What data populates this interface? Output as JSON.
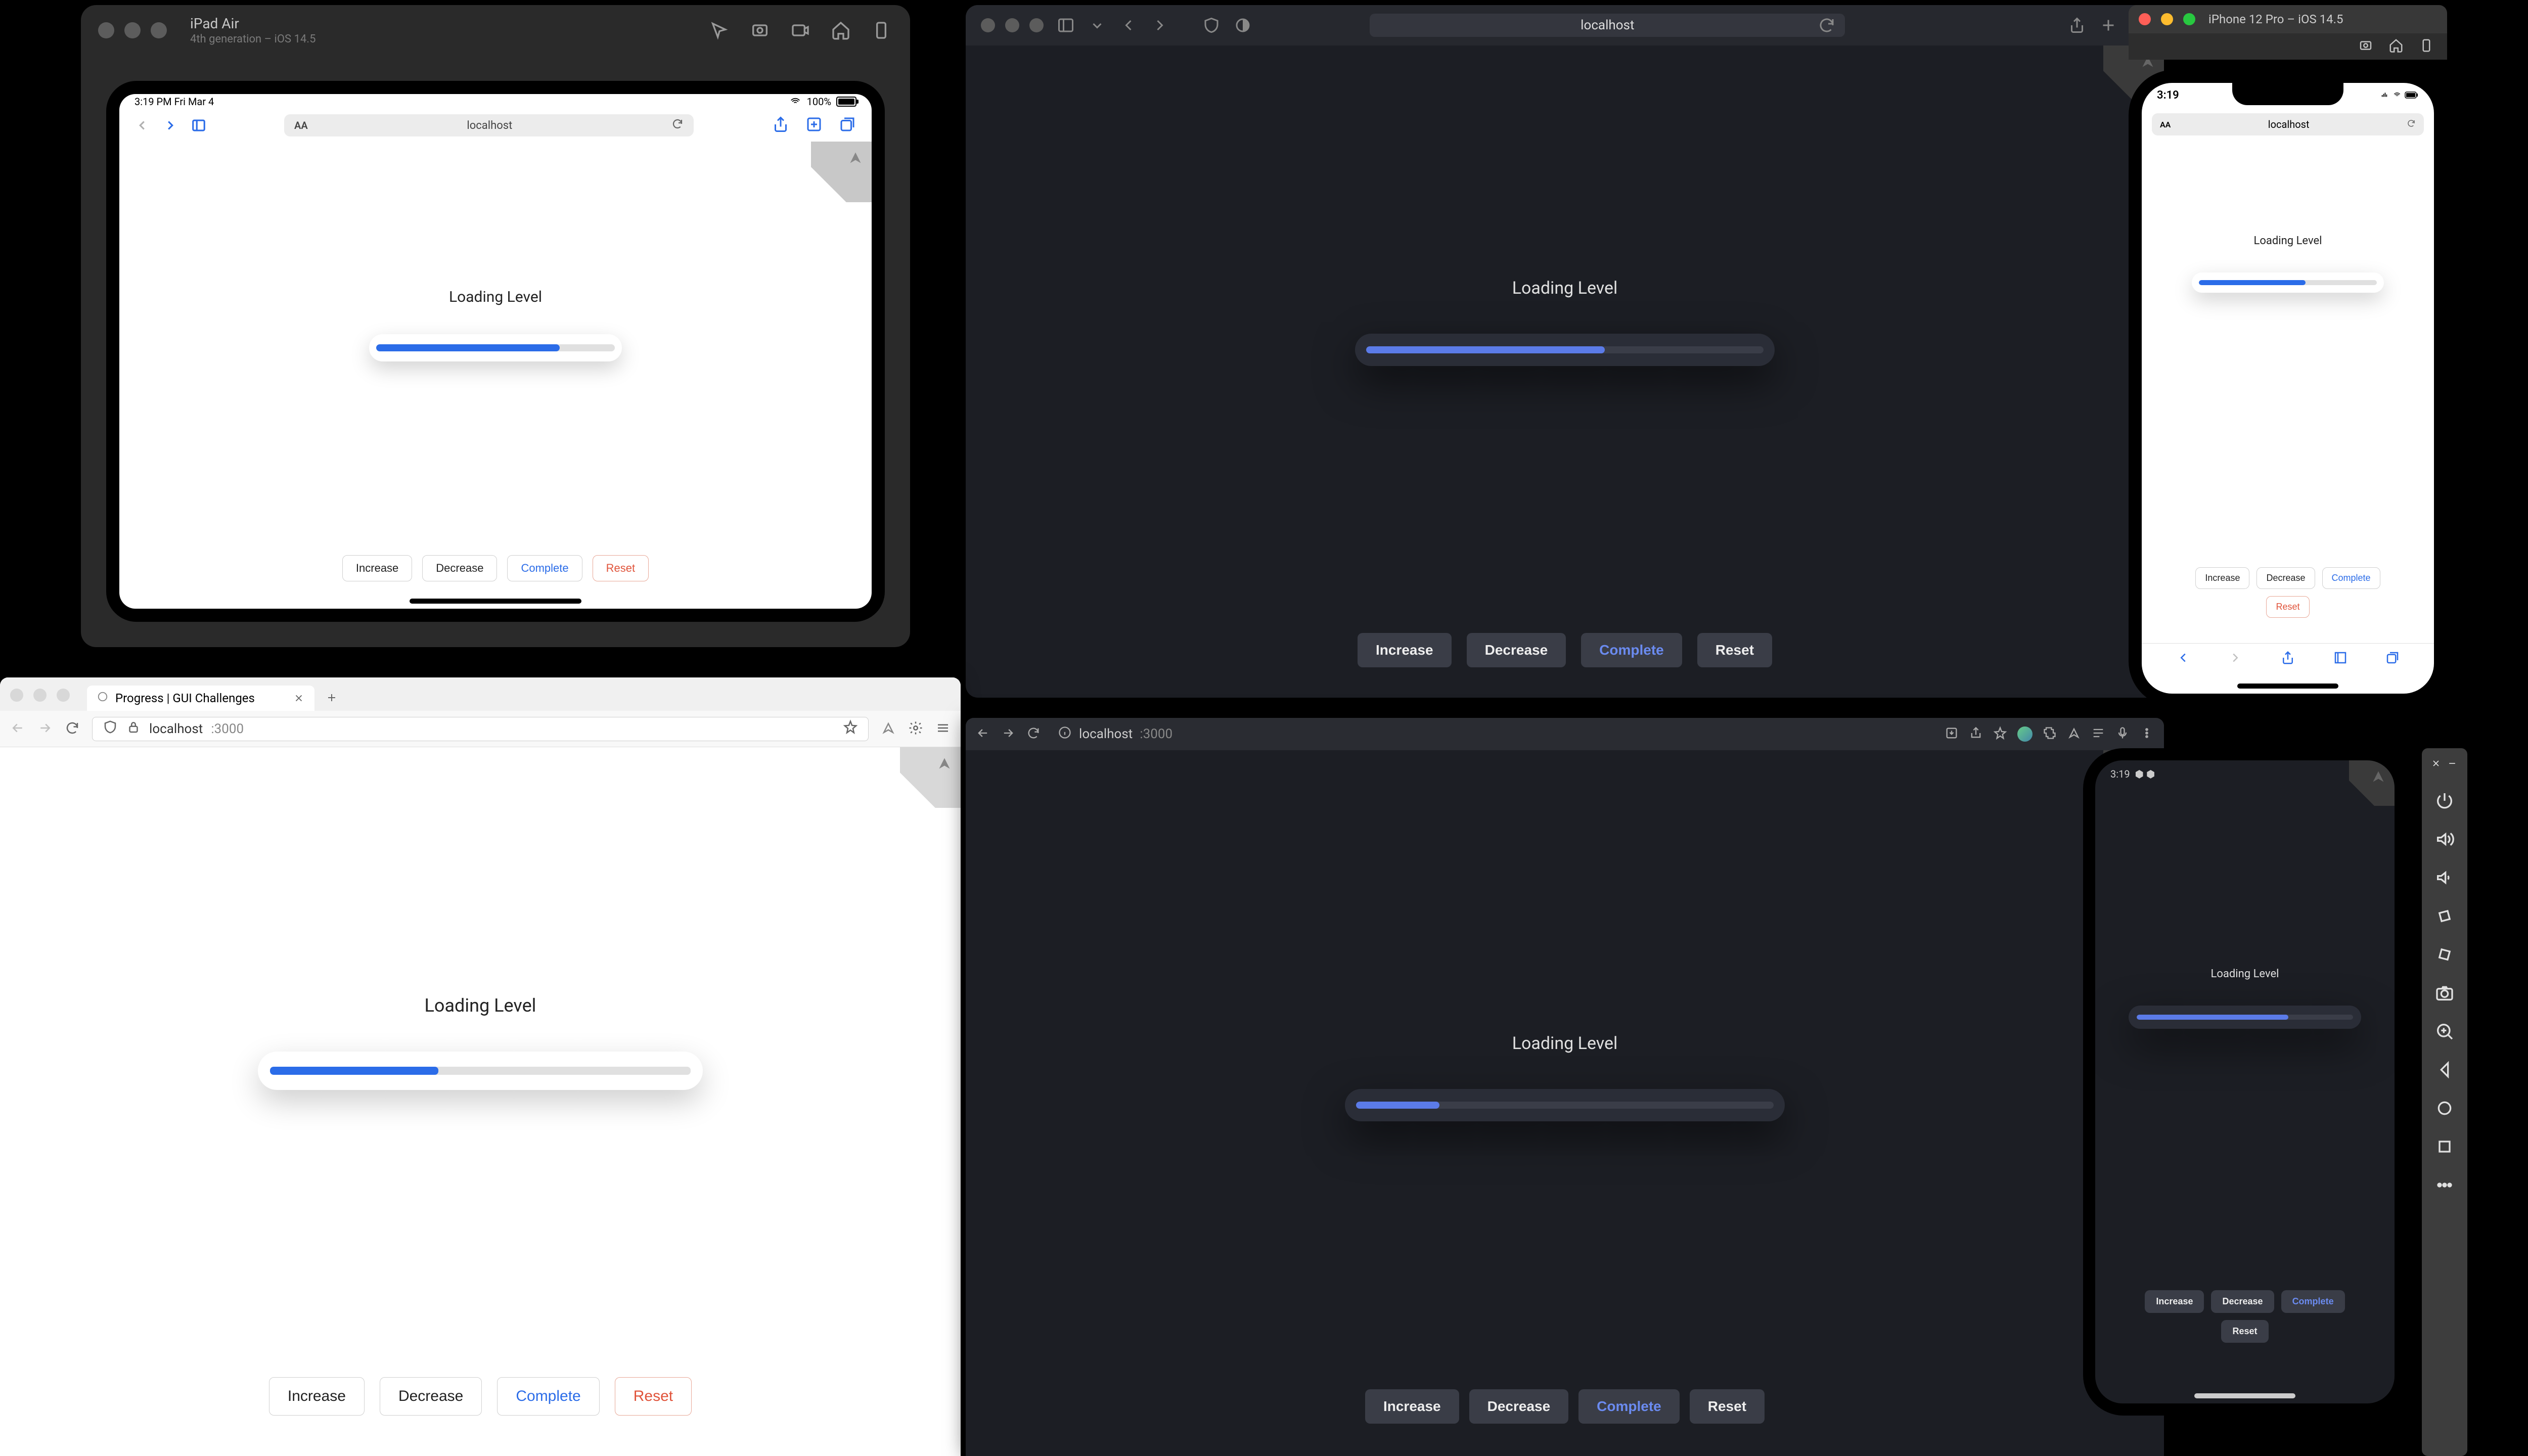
{
  "app": {
    "label": "Loading Level",
    "buttons": {
      "increase": "Increase",
      "decrease": "Decrease",
      "complete": "Complete",
      "reset": "Reset"
    }
  },
  "url": {
    "host": "localhost",
    "port": ":3000"
  },
  "ipad_sim": {
    "title": "iPad Air",
    "subtitle": "4th generation – iOS 14.5",
    "status_time": "3:19 PM  Fri Mar 4",
    "battery": "100%",
    "progress_pct": 77
  },
  "safari": {
    "progress_pct": 60
  },
  "iphone_sim": {
    "title": "iPhone 12 Pro – iOS 14.5",
    "status_time": "3:19",
    "progress_pct": 60
  },
  "firefox": {
    "tab_title": "Progress | GUI Challenges",
    "progress_pct": 40
  },
  "chrome": {
    "progress_pct": 20
  },
  "android": {
    "status_time": "3:19",
    "progress_pct": 70
  }
}
